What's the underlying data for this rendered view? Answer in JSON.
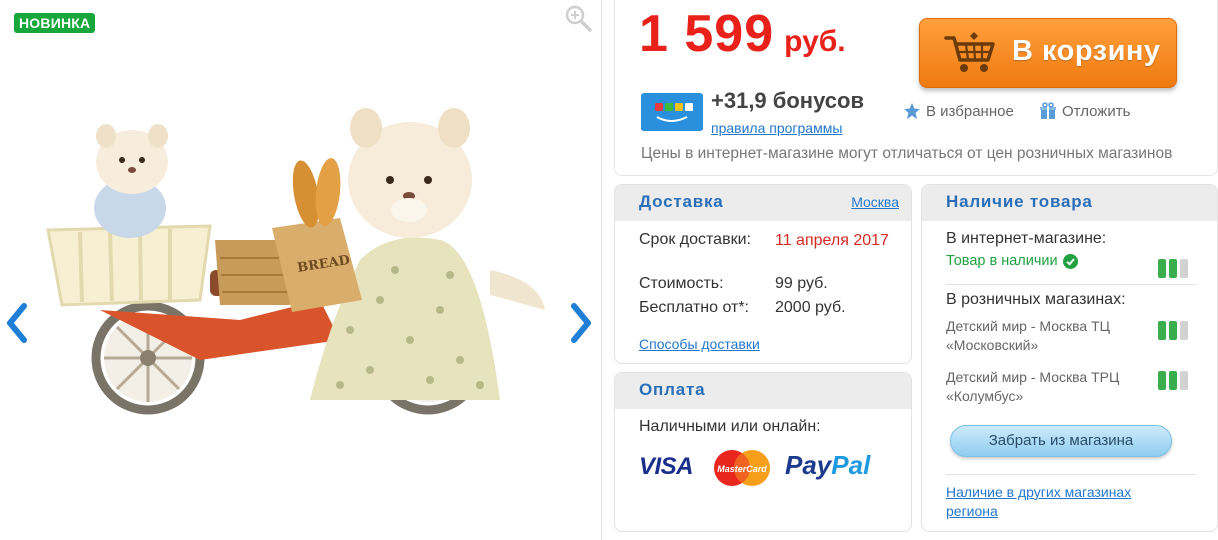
{
  "gallery": {
    "badge": "НОВИНКА"
  },
  "price": {
    "amount": "1 599",
    "currency": "руб.",
    "cart_button": "В корзину",
    "bonus": "+31,9 бонусов",
    "bonus_rules": "правила программы",
    "favorites": "В избранное",
    "defer": "Отложить",
    "note": "Цены в интернет-магазине могут отличаться от цен розничных магазинов"
  },
  "delivery": {
    "title": "Доставка",
    "city": "Москва",
    "term_label": "Срок доставки:",
    "term_value": "11 апреля 2017",
    "cost_label": "Стоимость:",
    "cost_value": "99 руб.",
    "free_label": "Бесплатно от*:",
    "free_value": "2000 руб.",
    "methods_link": "Способы доставки"
  },
  "payment": {
    "title": "Оплата",
    "text": "Наличными или онлайн:",
    "visa": "VISA",
    "mastercard": "MasterCard",
    "paypal_1": "Pay",
    "paypal_2": "Pal"
  },
  "stock": {
    "title": "Наличие товара",
    "online_label": "В интернет-магазине:",
    "online_status": "Товар в наличии",
    "retail_label": "В розничных магазинах:",
    "stores": [
      {
        "name": "Детский мир - Москва ТЦ «Московский»"
      },
      {
        "name": "Детский мир - Москва ТРЦ «Колумбус»"
      }
    ],
    "pickup_button": "Забрать из магазина",
    "other_stores_link": "Наличие в других магазинах региона"
  },
  "colors": {
    "price_red": "#e8211a",
    "cart_orange": "#f28b1c",
    "link_blue": "#2277cc",
    "stock_green": "#21a13f",
    "badge_green": "#17a73a"
  }
}
